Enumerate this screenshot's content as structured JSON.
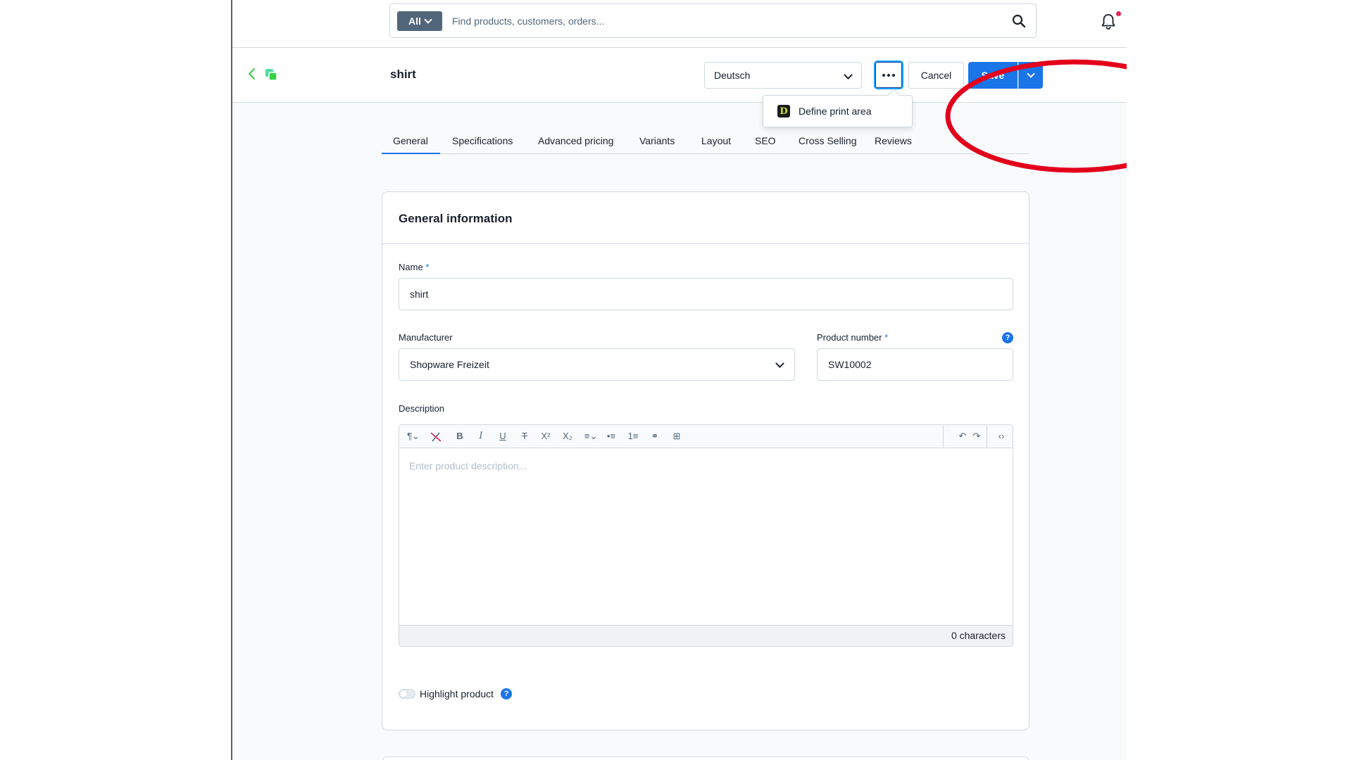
{
  "search": {
    "type_label": "All",
    "placeholder": "Find products, customers, orders..."
  },
  "header": {
    "title": "shirt",
    "language": "Deutsch",
    "cancel_label": "Cancel",
    "save_label": "Save"
  },
  "context_menu": {
    "item_label": "Define print area",
    "item_icon_letter": "D"
  },
  "tabs": [
    {
      "label": "General"
    },
    {
      "label": "Specifications"
    },
    {
      "label": "Advanced pricing"
    },
    {
      "label": "Variants"
    },
    {
      "label": "Layout"
    },
    {
      "label": "SEO"
    },
    {
      "label": "Cross Selling"
    },
    {
      "label": "Reviews"
    }
  ],
  "card": {
    "title": "General information",
    "name_label": "Name",
    "name_value": "shirt",
    "manufacturer_label": "Manufacturer",
    "manufacturer_value": "Shopware Freizeit",
    "product_number_label": "Product number",
    "product_number_value": "SW10002",
    "required_mark": "*",
    "description_label": "Description",
    "description_placeholder": "Enter product description...",
    "char_count": "0 characters",
    "highlight_label": "Highlight product",
    "help_glyph": "?"
  },
  "colors": {
    "accent": "#1a75e8",
    "annotation": "#e3001b",
    "notification": "#de294c"
  }
}
